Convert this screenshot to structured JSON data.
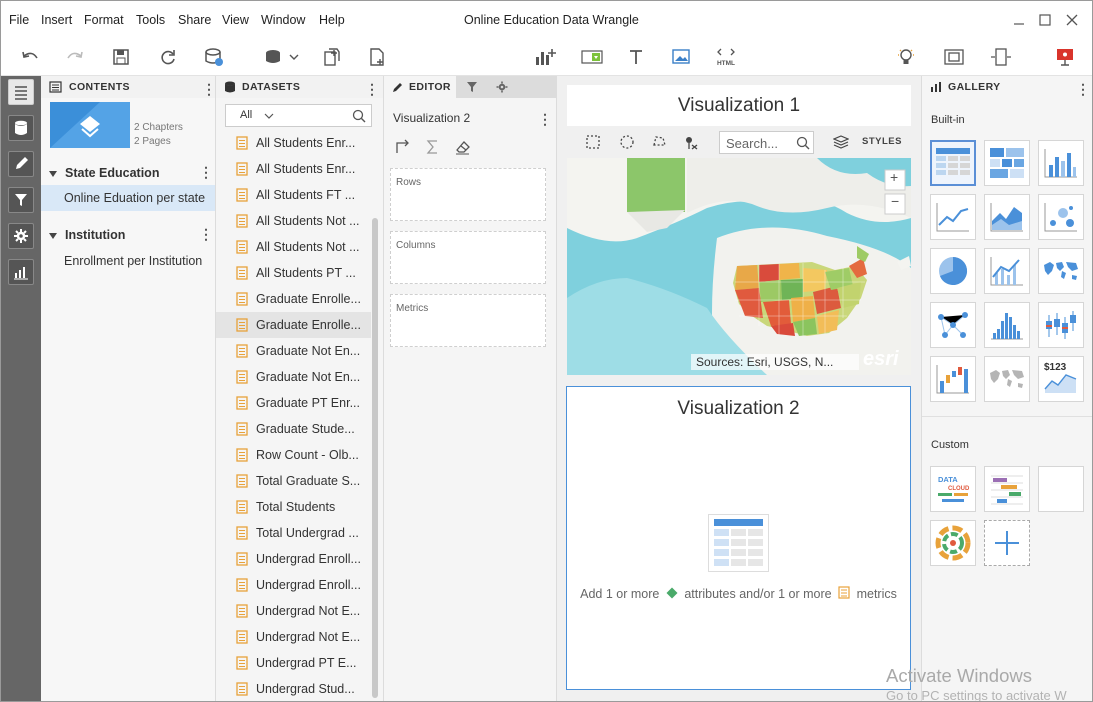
{
  "menu": [
    "File",
    "Insert",
    "Format",
    "Tools",
    "Share",
    "View",
    "Window",
    "Help"
  ],
  "window_title": "Online Education Data Wrangle",
  "contents": {
    "header": "CONTENTS",
    "dossier": {
      "chapters": "2 Chapters",
      "pages": "2 Pages"
    },
    "chapters": [
      {
        "title": "State Education",
        "pages": [
          "Online Eduation per state"
        ]
      },
      {
        "title": "Institution",
        "pages": [
          "Enrollment per Institution"
        ]
      }
    ]
  },
  "datasets": {
    "header": "DATASETS",
    "filter_value": "All",
    "items": [
      "All Students Enr...",
      "All Students Enr...",
      "All Students FT ...",
      "All Students Not ...",
      "All Students Not ...",
      "All Students PT ...",
      "Graduate Enrolle...",
      "Graduate Enrolle...",
      "Graduate Not En...",
      "Graduate Not En...",
      "Graduate PT Enr...",
      "Graduate Stude...",
      "Row Count - Olb...",
      "Total Graduate S...",
      "Total Students",
      "Total Undergrad ...",
      "Undergrad Enroll...",
      "Undergrad Enroll...",
      "Undergrad Not E...",
      "Undergrad Not E...",
      "Undergrad PT E...",
      "Undergrad Stud..."
    ]
  },
  "editor": {
    "tab_label": "EDITOR",
    "viz_name": "Visualization 2",
    "zones": [
      "Rows",
      "Columns",
      "Metrics"
    ]
  },
  "viz1": {
    "title": "Visualization 1",
    "search_placeholder": "Search...",
    "styles_label": "STYLES",
    "zoom_in": "+",
    "zoom_out": "−",
    "attribution": "Sources: Esri, USGS, N...",
    "esri": "esri"
  },
  "viz2": {
    "title": "Visualization 2",
    "hint_a": "Add 1 or more",
    "hint_b": "attributes and/or 1 or more",
    "hint_c": "metrics"
  },
  "gallery": {
    "header": "GALLERY",
    "builtin_label": "Built-in",
    "custom_label": "Custom",
    "money_label": "$123"
  },
  "watermark": {
    "line1": "Activate Windows",
    "line2": "Go to PC settings to activate W"
  },
  "colors": {
    "accent": "#4a90d9",
    "metric": "#e8a23a",
    "attribute": "#4aaa6a"
  }
}
